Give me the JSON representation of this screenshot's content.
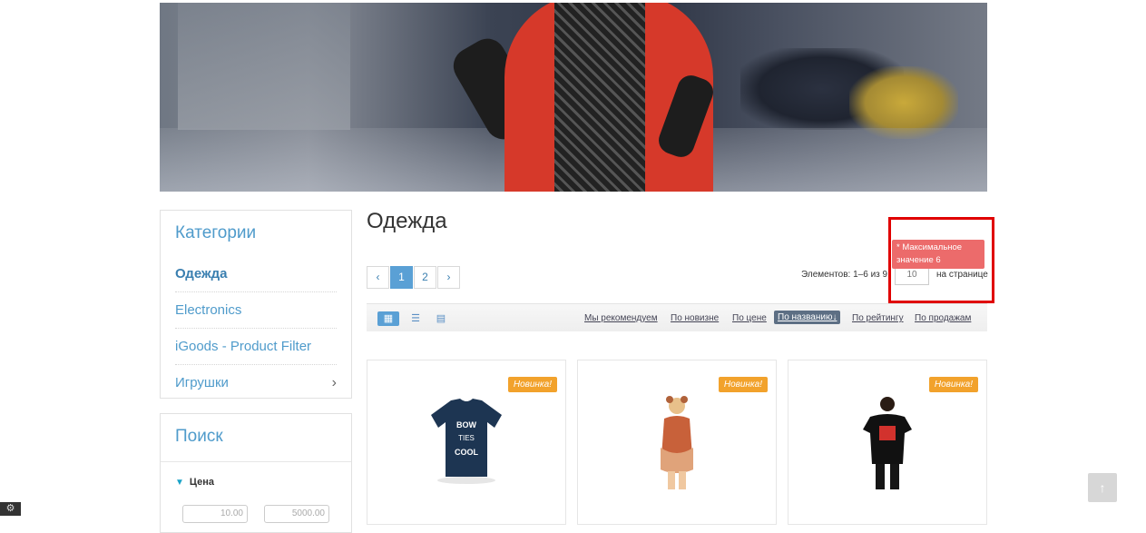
{
  "categories": {
    "title": "Категории",
    "items": [
      {
        "label": "Одежда"
      },
      {
        "label": "Electronics"
      },
      {
        "label": "iGoods - Product Filter"
      },
      {
        "label": "Игрушки",
        "chevron": "›"
      }
    ]
  },
  "search": {
    "title": "Поиск",
    "price_label": "Цена",
    "price_from": "10.00",
    "price_to": "5000.00"
  },
  "main": {
    "title": "Одежда",
    "pager": {
      "prev": "‹",
      "pages": [
        "1",
        "2"
      ],
      "next": "›",
      "active_page": "1"
    },
    "items_count": "Элементов: 1–6 из 9,",
    "per_page_value": "10",
    "per_page_label": "на странице",
    "tooltip": "* Максимальное значение 6"
  },
  "sort": {
    "links": [
      "Мы рекомендуем",
      "По новизне",
      "По цене",
      "По названию↓",
      "По рейтингу",
      "По продажам"
    ],
    "active": "По названию↓"
  },
  "products": [
    {
      "badge": "Новинка!",
      "image": "tshirt-bow-ties-cool",
      "shirt_text": [
        "BOW",
        "TIES",
        "COOL"
      ]
    },
    {
      "badge": "Новинка!",
      "image": "woman-orange-top"
    },
    {
      "badge": "Новинка!",
      "image": "woman-black-tshirt"
    }
  ],
  "colors": {
    "accent": "#4f9bcb",
    "badge": "#f2a22c",
    "tooltip": "#ec6b6b",
    "highlight": "#e00000"
  }
}
